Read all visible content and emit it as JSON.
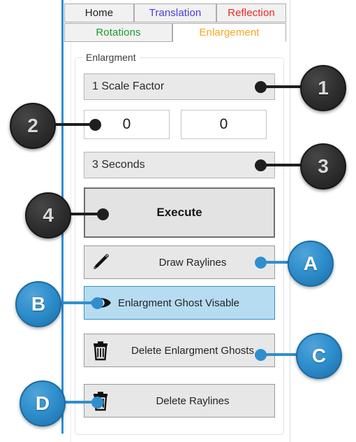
{
  "tabs": {
    "row1": [
      {
        "label": "Home",
        "color": "#202020",
        "active": false
      },
      {
        "label": "Translation",
        "color": "#4b3bdd",
        "active": false
      },
      {
        "label": "Reflection",
        "color": "#f4241e",
        "active": false
      }
    ],
    "row2": [
      {
        "label": "Rotations",
        "color": "#1f9a2e",
        "active": false
      },
      {
        "label": "Enlargement",
        "color": "#f5a623",
        "active": true
      }
    ]
  },
  "group": {
    "legend": "Enlargment"
  },
  "controls": {
    "scale_factor": "1 Scale Factor",
    "value_left": "0",
    "value_right": "0",
    "seconds": "3 Seconds",
    "execute": "Execute",
    "draw_raylines": "Draw Raylines",
    "ghost_visable": "Enlargment Ghost Visable",
    "delete_ghosts": "Delete Enlargment Ghosts",
    "delete_raylines": "Delete Raylines"
  },
  "icons": {
    "pencil": "pencil-icon",
    "eye": "eye-icon",
    "trash": "trash-icon"
  },
  "callouts": {
    "n1": "1",
    "n2": "2",
    "n3": "3",
    "n4": "4",
    "a": "A",
    "b": "B",
    "c": "C",
    "d": "D"
  },
  "colors": {
    "accent_blue": "#2f8fcd",
    "selected_fill": "#b6dcf2",
    "tab_active_text": "#f5a623",
    "callout_dark": "#1f1f1f"
  }
}
